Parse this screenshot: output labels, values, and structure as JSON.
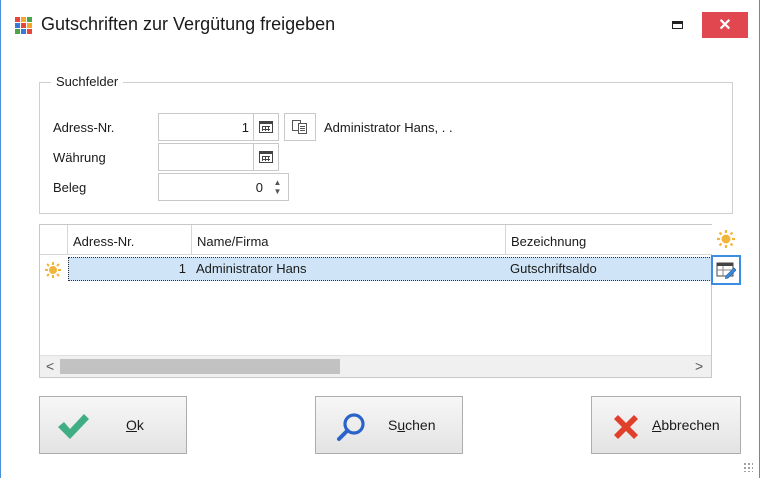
{
  "window": {
    "title": "Gutschriften zur Vergütung freigeben",
    "minimize_icon": "minimize-icon",
    "close_label": "✕",
    "icon_colors": [
      "#e8463c",
      "#f6a72a",
      "#4aa54a",
      "#3a78d8",
      "#e8463c",
      "#f6a72a",
      "#4aa54a",
      "#3a78d8",
      "#e8463c"
    ]
  },
  "search": {
    "legend": "Suchfelder",
    "adress_label": "Adress-Nr.",
    "adress_value": "1",
    "adress_name": "Administrator Hans, . .",
    "waehrung_label": "Währung",
    "waehrung_value": "",
    "beleg_label": "Beleg",
    "beleg_value": "0"
  },
  "grid": {
    "columns": [
      "Adress-Nr.",
      "Name/Firma",
      "Bezeichnung"
    ],
    "rows": [
      {
        "adress_nr": "1",
        "name": "Administrator Hans",
        "bezeichnung": "Gutschriftsaldo"
      }
    ],
    "scroll_left": "<",
    "scroll_right": ">"
  },
  "buttons": {
    "ok": {
      "prefix": "",
      "underlined": "O",
      "suffix": "k"
    },
    "search": {
      "prefix": "S",
      "underlined": "u",
      "suffix": "chen"
    },
    "cancel": {
      "prefix": "",
      "underlined": "A",
      "suffix": "bbrechen"
    }
  },
  "colors": {
    "accent": "#3a8de0",
    "selected_row": "#cfe5f7",
    "close_button": "#e0474f",
    "ok_check": "#3fae84",
    "cancel_x": "#e0402b"
  }
}
